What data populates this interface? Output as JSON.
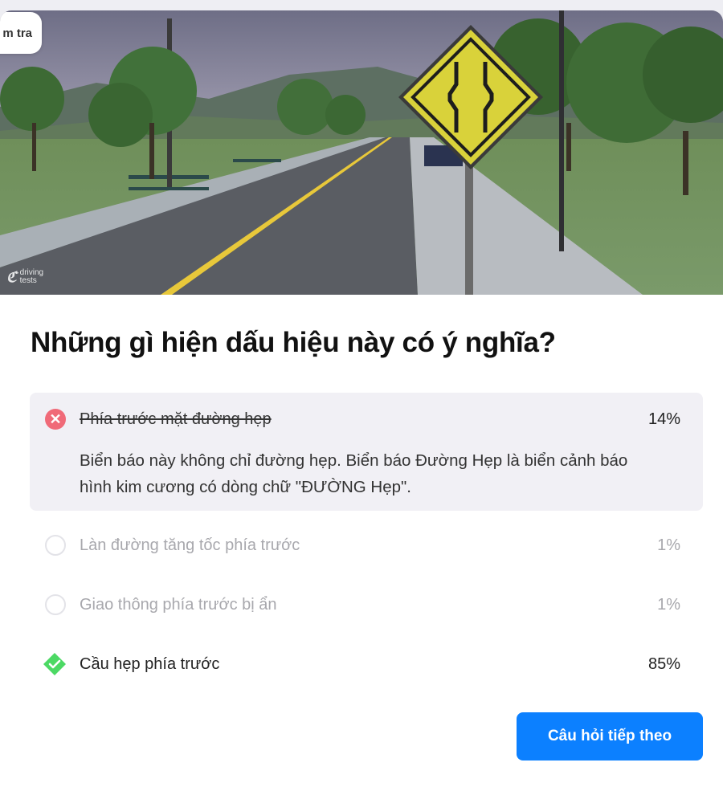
{
  "header": {
    "pill_label": "m tra"
  },
  "hero": {
    "watermark_line1": "driving",
    "watermark_line2": "tests",
    "sign_color": "#d9d23a"
  },
  "question": {
    "text": "Những gì hiện dấu hiệu này có ý nghĩa?"
  },
  "options": [
    {
      "label": "Phía trước mặt đường hẹp",
      "percent": "14%",
      "state": "wrong-selected",
      "explanation": "Biển báo này không chỉ đường hẹp. Biển báo Đường Hẹp là biển cảnh báo hình kim cương có dòng chữ \"ĐƯỜNG Hẹp\"."
    },
    {
      "label": "Làn đường tăng tốc phía trước",
      "percent": "1%",
      "state": "unselected"
    },
    {
      "label": "Giao thông phía trước bị ẩn",
      "percent": "1%",
      "state": "unselected"
    },
    {
      "label": "Cầu hẹp phía trước",
      "percent": "85%",
      "state": "correct"
    }
  ],
  "actions": {
    "next_label": "Câu hỏi tiếp theo"
  },
  "colors": {
    "wrong": "#f06a78",
    "correct": "#4cd964",
    "primary": "#0c80ff"
  }
}
